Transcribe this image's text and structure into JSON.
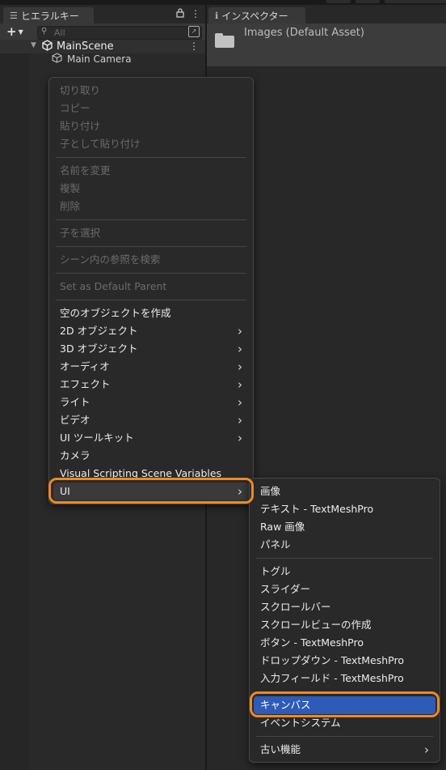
{
  "hierarchy": {
    "tab_label": "ヒエラルキー",
    "search_placeholder": "All",
    "scene_name": "MainScene",
    "items": [
      {
        "label": "Main Camera"
      }
    ]
  },
  "inspector": {
    "tab_label": "インスペクター",
    "asset_title": "Images (Default Asset)"
  },
  "context_menu": {
    "items": [
      {
        "label": "切り取り",
        "enabled": false
      },
      {
        "label": "コピー",
        "enabled": false
      },
      {
        "label": "貼り付け",
        "enabled": false
      },
      {
        "label": "子として貼り付け",
        "enabled": false
      },
      {
        "label": "名前を変更",
        "enabled": false
      },
      {
        "label": "複製",
        "enabled": false
      },
      {
        "label": "削除",
        "enabled": false
      },
      {
        "label": "子を選択",
        "enabled": false
      },
      {
        "label": "シーン内の参照を検索",
        "enabled": false
      },
      {
        "label": "Set as Default Parent",
        "enabled": false
      },
      {
        "label": "空のオブジェクトを作成",
        "enabled": true
      },
      {
        "label": "2D オブジェクト",
        "enabled": true,
        "submenu": true
      },
      {
        "label": "3D オブジェクト",
        "enabled": true,
        "submenu": true
      },
      {
        "label": "オーディオ",
        "enabled": true,
        "submenu": true
      },
      {
        "label": "エフェクト",
        "enabled": true,
        "submenu": true
      },
      {
        "label": "ライト",
        "enabled": true,
        "submenu": true
      },
      {
        "label": "ビデオ",
        "enabled": true,
        "submenu": true
      },
      {
        "label": "UI ツールキット",
        "enabled": true,
        "submenu": true
      },
      {
        "label": "カメラ",
        "enabled": true
      },
      {
        "label": "Visual Scripting Scene Variables",
        "enabled": true
      },
      {
        "label": "UI",
        "enabled": true,
        "submenu": true,
        "state": "open"
      }
    ]
  },
  "ui_submenu": {
    "items": [
      {
        "label": "画像"
      },
      {
        "label": "テキスト - TextMeshPro"
      },
      {
        "label": "Raw 画像"
      },
      {
        "label": "パネル"
      },
      {
        "label": "トグル"
      },
      {
        "label": "スライダー"
      },
      {
        "label": "スクロールバー"
      },
      {
        "label": "スクロールビューの作成"
      },
      {
        "label": "ボタン - TextMeshPro"
      },
      {
        "label": "ドロップダウン - TextMeshPro"
      },
      {
        "label": "入力フィールド - TextMeshPro"
      },
      {
        "label": "キャンバス",
        "state": "selected"
      },
      {
        "label": "イベントシステム"
      },
      {
        "label": "古い機能",
        "submenu": true
      }
    ]
  },
  "colors": {
    "highlight": "#2d5bb8",
    "callout_ring": "#f0891e"
  }
}
